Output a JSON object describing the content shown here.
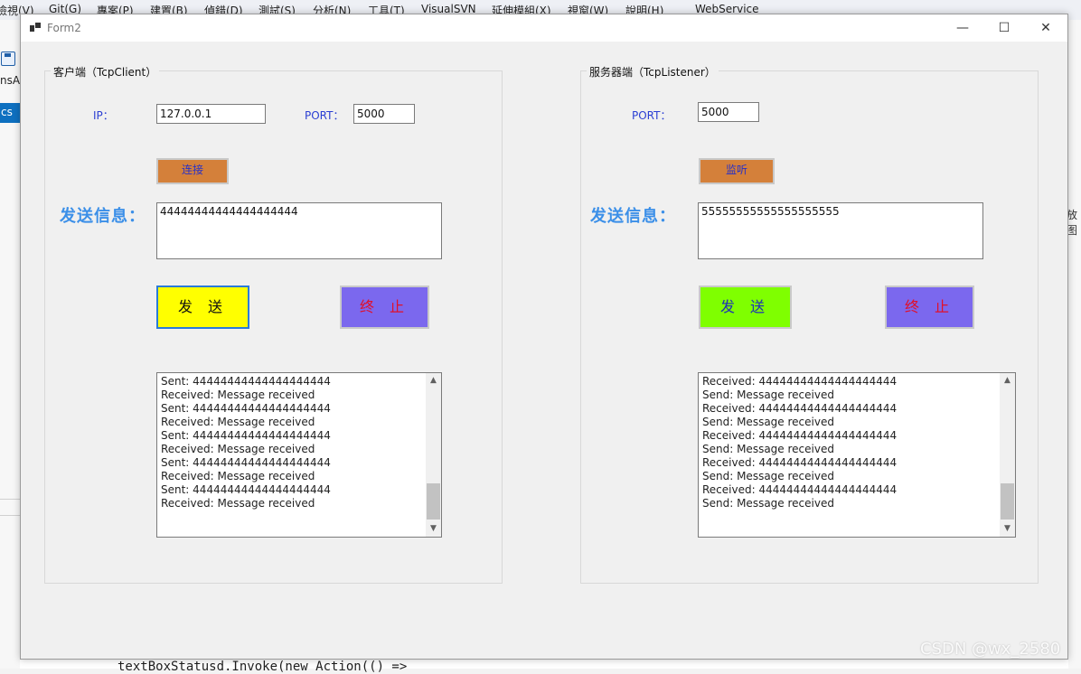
{
  "ide": {
    "menu": [
      "檢視(V)",
      "Git(G)",
      "專案(P)",
      "建置(B)",
      "偵錯(D)",
      "測試(S)",
      "分析(N)",
      "工具(T)",
      "VisualSVN",
      "延伸模組(X)",
      "視窗(W)",
      "說明(H)",
      "WebService"
    ],
    "left_text": "nsAp",
    "left_tab": "cs",
    "right_text": "放图",
    "code_line": "textBoxStatusd.Invoke(new Action(() =>"
  },
  "watermark": "CSDN @wx_2580",
  "window": {
    "title": "Form2",
    "controls": {
      "minimize": "—",
      "maximize": "☐",
      "close": "✕"
    }
  },
  "client": {
    "group_title": "客户端（TcpClient）",
    "ip_label": "IP：",
    "ip_value": "127.0.0.1",
    "port_label": "PORT：",
    "port_value": "5000",
    "connect_button": "连接",
    "send_info_label": "发送信息：",
    "message_value": "44444444444444444444",
    "send_button": "发 送",
    "stop_button": "终 止",
    "log": [
      "Sent: 44444444444444444444",
      "Received: Message received",
      "Sent: 44444444444444444444",
      "Received: Message received",
      "Sent: 44444444444444444444",
      "Received: Message received",
      "Sent: 44444444444444444444",
      "Received: Message received",
      "Sent: 44444444444444444444",
      "Received: Message received"
    ]
  },
  "server": {
    "group_title": "服务器端（TcpListener）",
    "port_label": "PORT：",
    "port_value": "5000",
    "listen_button": "监听",
    "send_info_label": "发送信息：",
    "message_value": "55555555555555555555",
    "send_button": "发 送",
    "stop_button": "终 止",
    "log": [
      "Received: 44444444444444444444",
      "Send: Message received",
      "Received: 44444444444444444444",
      "Send: Message received",
      "Received: 44444444444444444444",
      "Send: Message received",
      "Received: 44444444444444444444",
      "Send: Message received",
      "Received: 44444444444444444444",
      "Send: Message received"
    ]
  },
  "colors": {
    "client_send_bg": "#ffff00",
    "server_send_bg": "#7fff00",
    "stop_bg": "#7b68ee",
    "stop_text": "#e0102a",
    "small_button_bg": "#d4803a",
    "label_blue": "#2b3fd3",
    "big_label": "#3b8fe8"
  }
}
